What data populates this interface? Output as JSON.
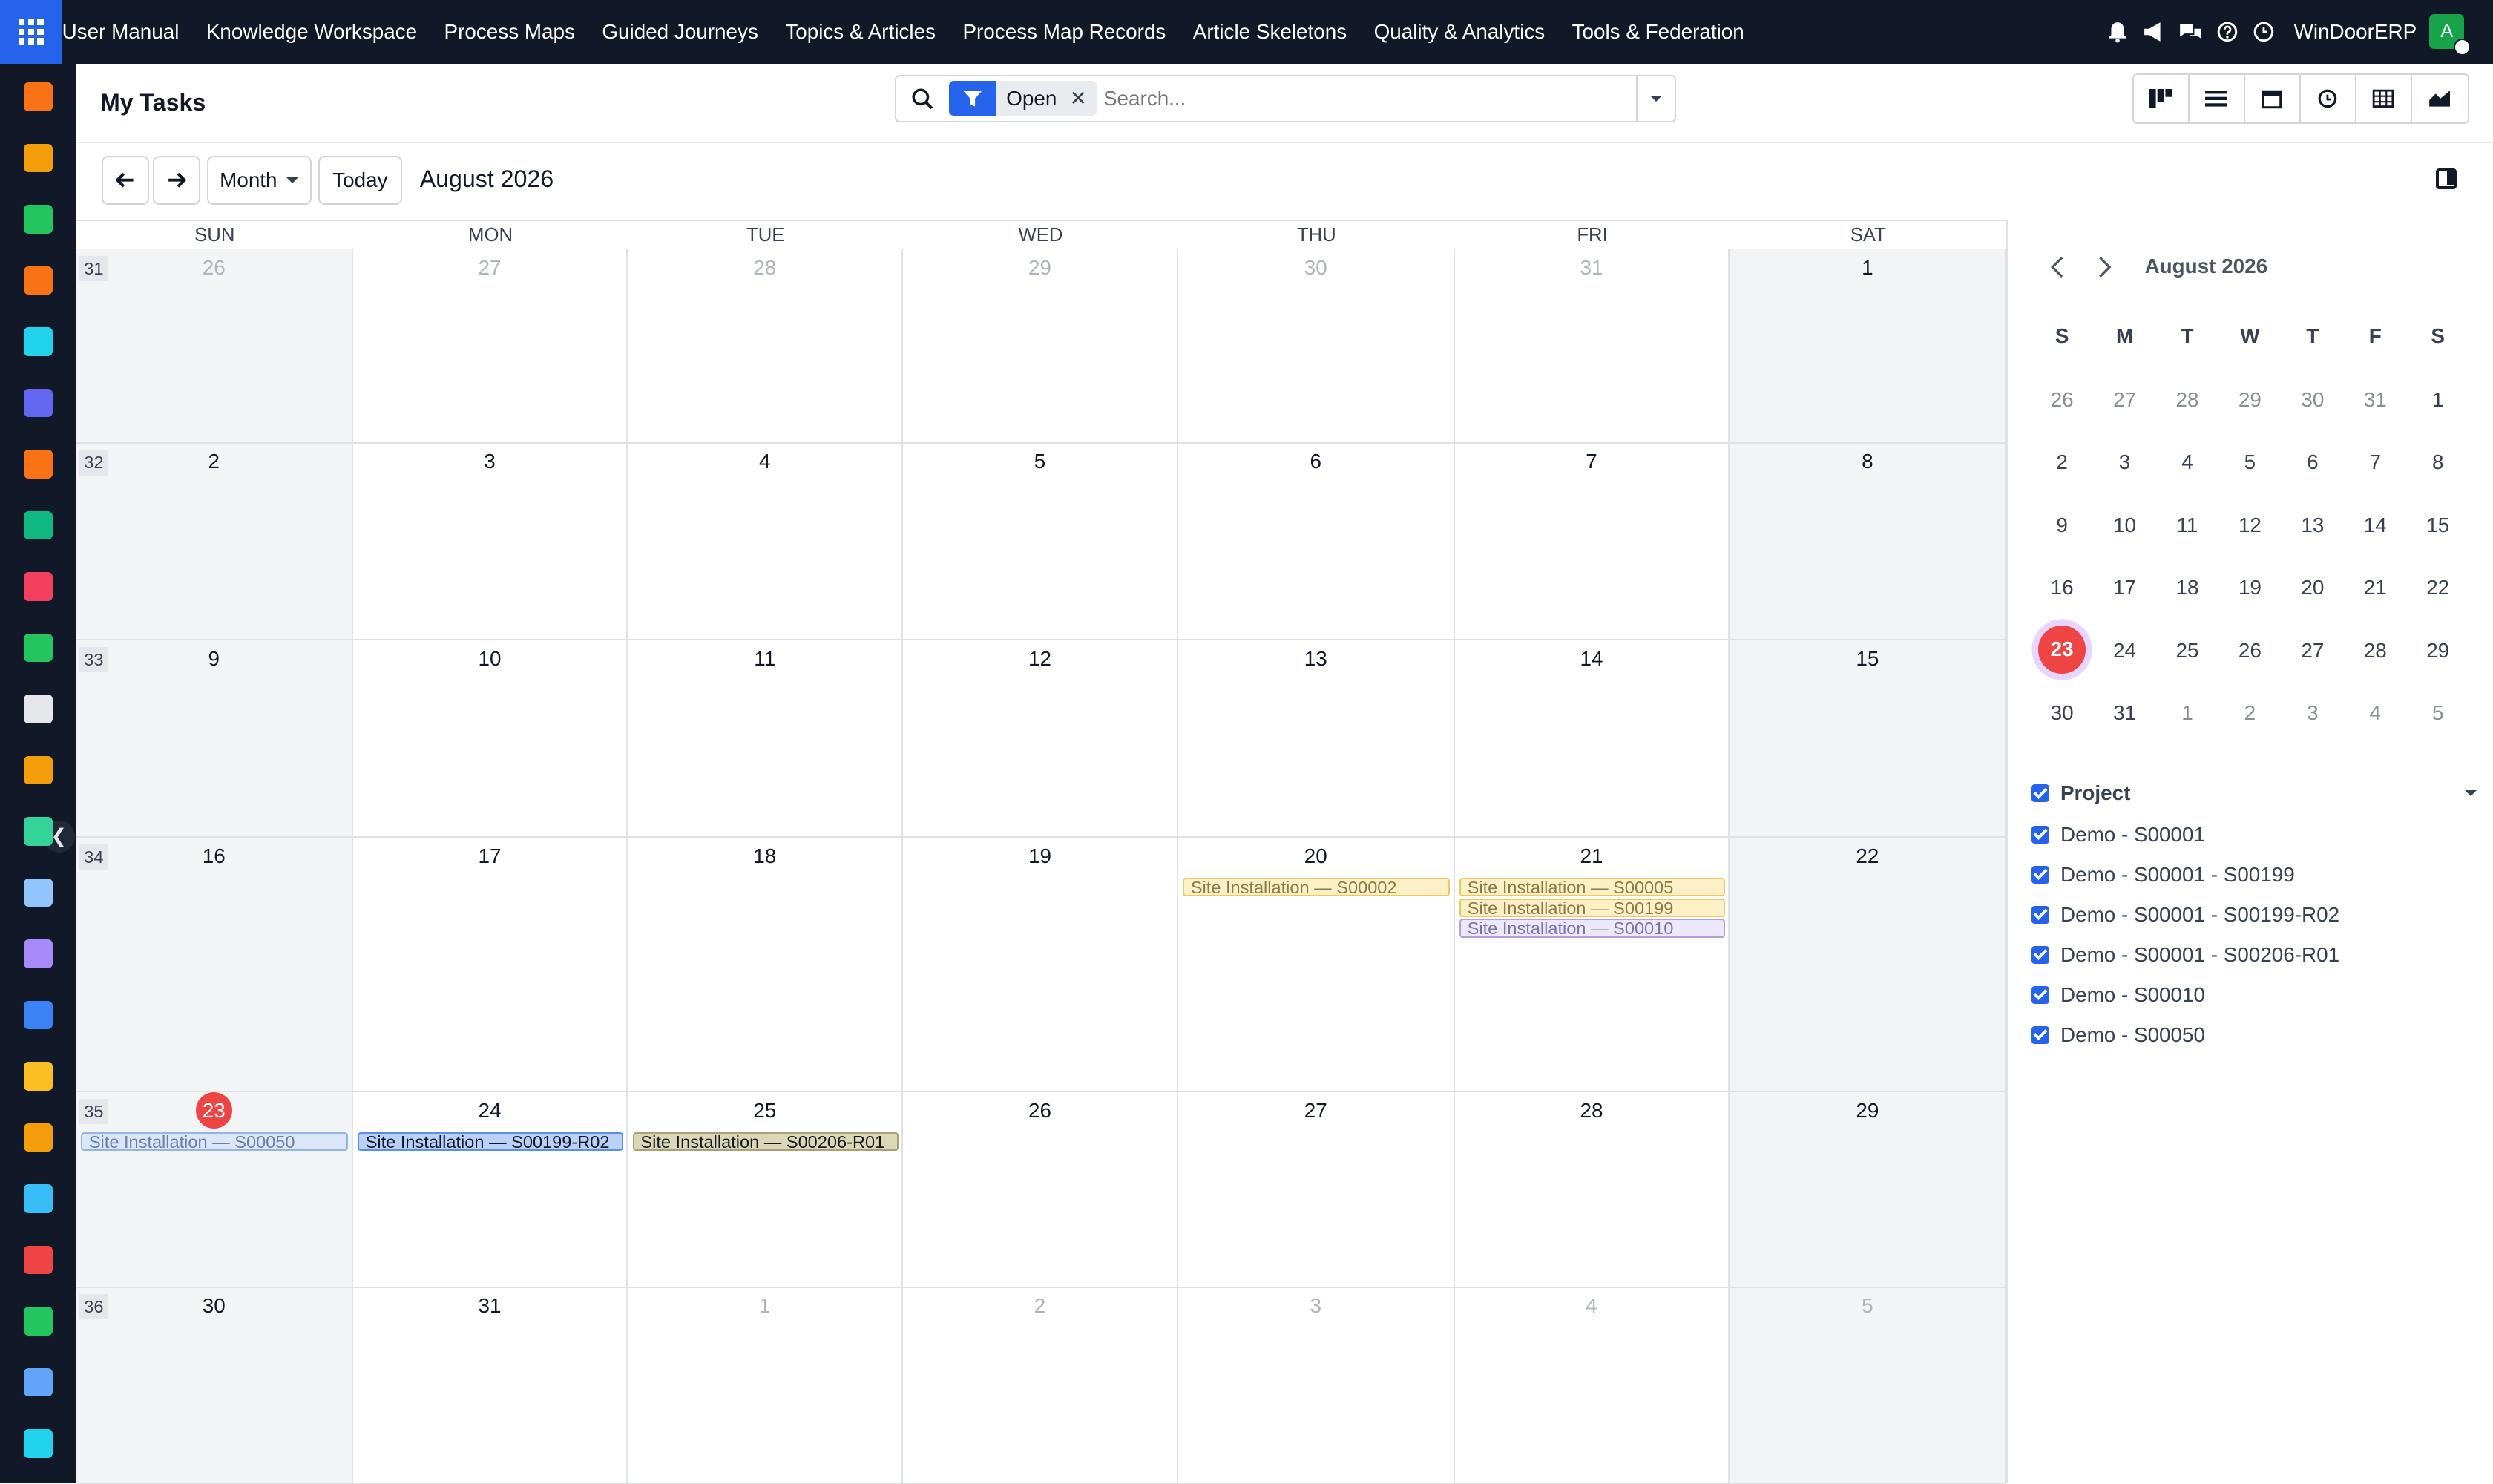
{
  "topbar": {
    "menu": [
      "User Manual",
      "Knowledge Workspace",
      "Process Maps",
      "Guided Journeys",
      "Topics & Articles",
      "Process Map Records",
      "Article Skeletons",
      "Quality & Analytics",
      "Tools & Federation"
    ],
    "company": "WinDoorERP",
    "avatar_initial": "A"
  },
  "sidebar": {
    "apps": [
      {
        "icon": "bar-chart-app-icon",
        "color": "#f97316"
      },
      {
        "icon": "gallery-app-icon",
        "color": "#f59e0b"
      },
      {
        "icon": "contacts-app-icon",
        "color": "#22c55e"
      },
      {
        "icon": "chat-bubble-app-icon",
        "color": "#f97316"
      },
      {
        "icon": "sphere-app-icon",
        "color": "#22d3ee"
      },
      {
        "icon": "mail-app-icon",
        "color": "#6366f1"
      },
      {
        "icon": "discuss-app-icon",
        "color": "#f97316"
      },
      {
        "icon": "chevron-app-icon",
        "color": "#10b981"
      },
      {
        "icon": "report-app-icon",
        "color": "#f43f5e"
      },
      {
        "icon": "employee-app-icon",
        "color": "#22c55e"
      },
      {
        "icon": "cube-app-icon",
        "color": "#e5e7eb"
      },
      {
        "icon": "paint-app-icon",
        "color": "#f59e0b"
      },
      {
        "icon": "todo-app-icon",
        "color": "#34d399"
      },
      {
        "icon": "book-app-icon",
        "color": "#93c5fd"
      },
      {
        "icon": "package-app-icon",
        "color": "#a78bfa"
      },
      {
        "icon": "invoice-app-icon",
        "color": "#3b82f6"
      },
      {
        "icon": "team-app-icon",
        "color": "#fbbf24"
      },
      {
        "icon": "calendar-31-app-icon",
        "color": "#f59e0b"
      },
      {
        "icon": "sign-app-icon",
        "color": "#38bdf8"
      },
      {
        "icon": "dashboard-app-icon",
        "color": "#ef4444"
      },
      {
        "icon": "whatsapp-app-icon",
        "color": "#22c55e"
      },
      {
        "icon": "clock-app-icon",
        "color": "#60a5fa"
      },
      {
        "icon": "wave-app-icon",
        "color": "#22d3ee"
      }
    ]
  },
  "controls": {
    "title": "My Tasks",
    "facet_value": "Open",
    "search_placeholder": "Search...",
    "views": [
      "kanban-view-icon",
      "list-view-icon",
      "calendar-view-icon",
      "activity-view-icon",
      "pivot-view-icon",
      "graph-view-icon"
    ]
  },
  "nav": {
    "scale": "Month",
    "today": "Today",
    "range": "August 2026"
  },
  "calendar": {
    "weekdays": [
      "SUN",
      "MON",
      "TUE",
      "WED",
      "THU",
      "FRI",
      "SAT"
    ],
    "weeks": [
      {
        "no": "31",
        "days": [
          {
            "d": "26",
            "other": true
          },
          {
            "d": "27",
            "other": true
          },
          {
            "d": "28",
            "other": true
          },
          {
            "d": "29",
            "other": true
          },
          {
            "d": "30",
            "other": true
          },
          {
            "d": "31",
            "other": true
          },
          {
            "d": "1"
          }
        ]
      },
      {
        "no": "32",
        "days": [
          {
            "d": "2"
          },
          {
            "d": "3"
          },
          {
            "d": "4"
          },
          {
            "d": "5"
          },
          {
            "d": "6"
          },
          {
            "d": "7"
          },
          {
            "d": "8"
          }
        ]
      },
      {
        "no": "33",
        "days": [
          {
            "d": "9"
          },
          {
            "d": "10"
          },
          {
            "d": "11"
          },
          {
            "d": "12"
          },
          {
            "d": "13"
          },
          {
            "d": "14"
          },
          {
            "d": "15"
          }
        ]
      },
      {
        "no": "34",
        "days": [
          {
            "d": "16"
          },
          {
            "d": "17"
          },
          {
            "d": "18"
          },
          {
            "d": "19"
          },
          {
            "d": "20"
          },
          {
            "d": "21"
          },
          {
            "d": "22"
          }
        ]
      },
      {
        "no": "35",
        "days": [
          {
            "d": "23",
            "today": true
          },
          {
            "d": "24"
          },
          {
            "d": "25"
          },
          {
            "d": "26"
          },
          {
            "d": "27"
          },
          {
            "d": "28"
          },
          {
            "d": "29"
          }
        ]
      },
      {
        "no": "36",
        "days": [
          {
            "d": "30"
          },
          {
            "d": "31"
          },
          {
            "d": "1",
            "other": true
          },
          {
            "d": "2",
            "other": true
          },
          {
            "d": "3",
            "other": true
          },
          {
            "d": "4",
            "other": true
          },
          {
            "d": "5",
            "other": true
          }
        ]
      }
    ],
    "events": [
      {
        "title": "Site Installation — S00002",
        "week": 3,
        "day": 4,
        "slot": 0,
        "bg": "#fdf0c7",
        "border": "#f0c75e",
        "color": "#8a7a45"
      },
      {
        "title": "Site Installation — S00005",
        "week": 3,
        "day": 5,
        "slot": 0,
        "bg": "#fdf0c7",
        "border": "#f0c75e",
        "color": "#8a7a45"
      },
      {
        "title": "Site Installation — S00199",
        "week": 3,
        "day": 5,
        "slot": 1,
        "bg": "#fdf0c7",
        "border": "#f0c75e",
        "color": "#8a7a45"
      },
      {
        "title": "Site Installation — S00010",
        "week": 3,
        "day": 5,
        "slot": 2,
        "bg": "#ede7fb",
        "border": "#b39ddb",
        "color": "#7e73a0"
      },
      {
        "title": "Site Installation — S00050",
        "week": 4,
        "day": 0,
        "slot": 0,
        "bg": "#dbe7f8",
        "border": "#94b4e3",
        "color": "#6b7f9e"
      },
      {
        "title": "Site Installation — S00199-R02",
        "week": 4,
        "day": 1,
        "slot": 0,
        "bg": "#b9d1f7",
        "border": "#5b8ee6",
        "color": "#111827"
      },
      {
        "title": "Site Installation — S00206-R01",
        "week": 4,
        "day": 2,
        "slot": 0,
        "bg": "#dcd7b4",
        "border": "#a8a077",
        "color": "#111827"
      }
    ]
  },
  "mini_calendar": {
    "title": "August 2026",
    "weekdays": [
      "S",
      "M",
      "T",
      "W",
      "T",
      "F",
      "S"
    ],
    "rows": [
      [
        {
          "d": "26",
          "o": true
        },
        {
          "d": "27",
          "o": true
        },
        {
          "d": "28",
          "o": true
        },
        {
          "d": "29",
          "o": true
        },
        {
          "d": "30",
          "o": true
        },
        {
          "d": "31",
          "o": true
        },
        {
          "d": "1"
        }
      ],
      [
        {
          "d": "2"
        },
        {
          "d": "3"
        },
        {
          "d": "4"
        },
        {
          "d": "5"
        },
        {
          "d": "6"
        },
        {
          "d": "7"
        },
        {
          "d": "8"
        }
      ],
      [
        {
          "d": "9"
        },
        {
          "d": "10"
        },
        {
          "d": "11"
        },
        {
          "d": "12"
        },
        {
          "d": "13"
        },
        {
          "d": "14"
        },
        {
          "d": "15"
        }
      ],
      [
        {
          "d": "16"
        },
        {
          "d": "17"
        },
        {
          "d": "18"
        },
        {
          "d": "19"
        },
        {
          "d": "20"
        },
        {
          "d": "21"
        },
        {
          "d": "22"
        }
      ],
      [
        {
          "d": "23",
          "t": true
        },
        {
          "d": "24"
        },
        {
          "d": "25"
        },
        {
          "d": "26"
        },
        {
          "d": "27"
        },
        {
          "d": "28"
        },
        {
          "d": "29"
        }
      ],
      [
        {
          "d": "30"
        },
        {
          "d": "31"
        },
        {
          "d": "1",
          "o": true
        },
        {
          "d": "2",
          "o": true
        },
        {
          "d": "3",
          "o": true
        },
        {
          "d": "4",
          "o": true
        },
        {
          "d": "5",
          "o": true
        }
      ]
    ]
  },
  "filters": {
    "group_label": "Project",
    "items": [
      "Demo - S00001",
      "Demo - S00001 - S00199",
      "Demo - S00001 - S00199-R02",
      "Demo - S00001 - S00206-R01",
      "Demo - S00010",
      "Demo - S00050"
    ]
  }
}
